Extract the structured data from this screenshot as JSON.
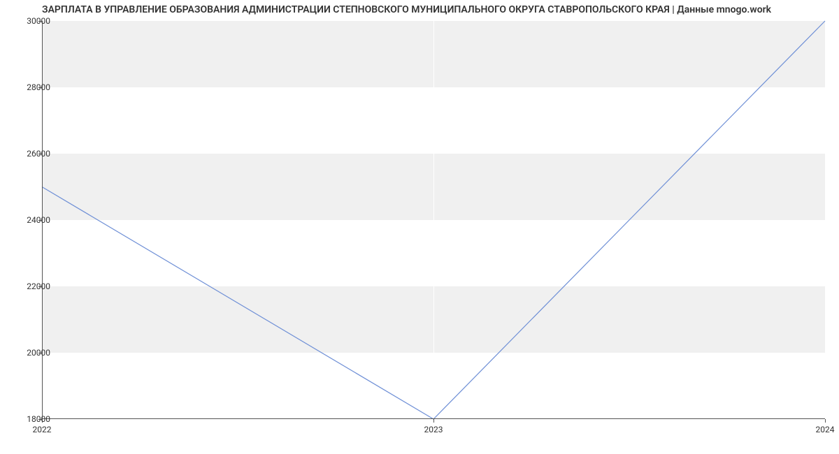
{
  "chart_data": {
    "type": "line",
    "title": "ЗАРПЛАТА В УПРАВЛЕНИЕ ОБРАЗОВАНИЯ АДМИНИСТРАЦИИ СТЕПНОВСКОГО МУНИЦИПАЛЬНОГО ОКРУГА СТАВРОПОЛЬСКОГО КРАЯ | Данные mnogo.work",
    "xlabel": "",
    "ylabel": "",
    "x_categories": [
      "2022",
      "2023",
      "2024"
    ],
    "series": [
      {
        "name": "salary",
        "values": [
          25000,
          18000,
          30000
        ],
        "color": "#6e8fd6"
      }
    ],
    "ylim": [
      18000,
      30000
    ],
    "y_ticks": [
      18000,
      20000,
      22000,
      24000,
      26000,
      28000,
      30000
    ],
    "x_ticks": [
      "2022",
      "2023",
      "2024"
    ],
    "grid": true
  }
}
